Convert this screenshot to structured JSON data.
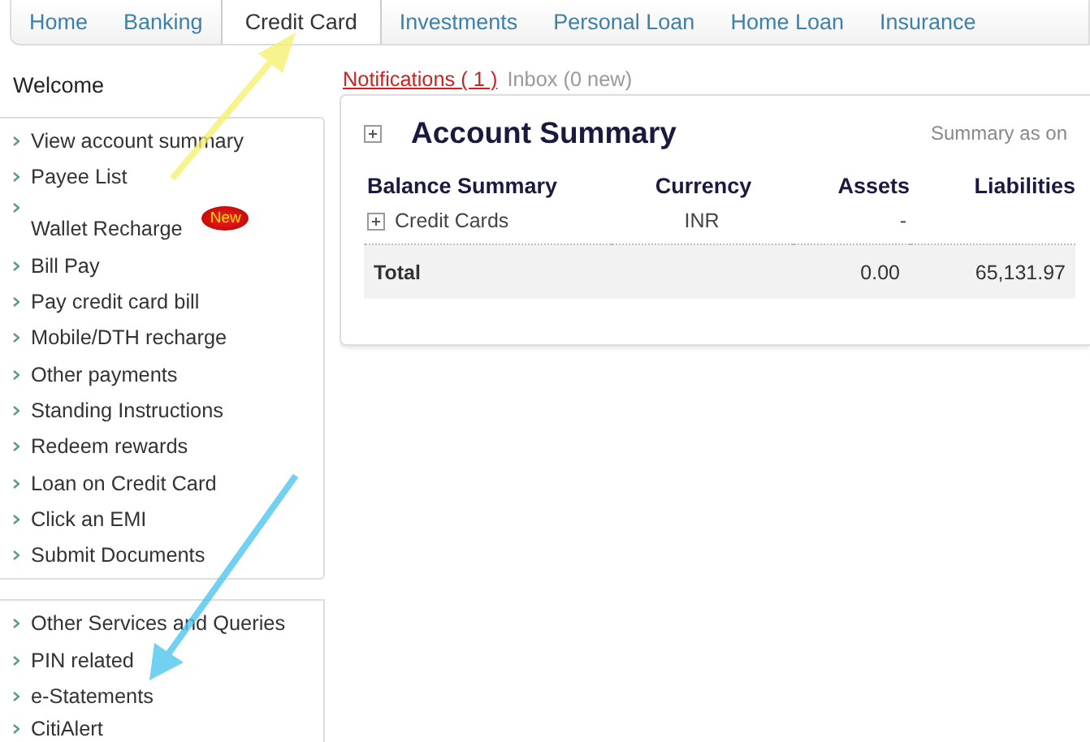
{
  "nav": {
    "tabs": [
      {
        "label": "Home",
        "selected": false
      },
      {
        "label": "Banking",
        "selected": false
      },
      {
        "label": "Credit Card",
        "selected": true
      },
      {
        "label": "Investments",
        "selected": false
      },
      {
        "label": "Personal Loan",
        "selected": false
      },
      {
        "label": "Home Loan",
        "selected": false
      },
      {
        "label": "Insurance",
        "selected": false
      }
    ]
  },
  "welcome": "Welcome",
  "sidebar": {
    "groups": [
      {
        "items": [
          {
            "label": "View account summary"
          },
          {
            "label": "Payee List"
          },
          {
            "label": "Wallet Recharge",
            "badge": "New"
          },
          {
            "label": "Bill Pay"
          },
          {
            "label": "Pay credit card bill"
          },
          {
            "label": "Mobile/DTH recharge"
          },
          {
            "label": "Other payments"
          },
          {
            "label": "Standing Instructions"
          },
          {
            "label": "Redeem rewards"
          },
          {
            "label": "Loan on Credit Card"
          },
          {
            "label": "Click an EMI"
          },
          {
            "label": "Submit Documents"
          }
        ]
      },
      {
        "items": [
          {
            "label": "Other Services and Queries"
          },
          {
            "label": "PIN related"
          },
          {
            "label": "e-Statements"
          },
          {
            "label": "CitiAlert"
          }
        ]
      }
    ]
  },
  "messages": {
    "notifications": "Notifications ( 1 )",
    "inbox": "Inbox (0 new)"
  },
  "summary": {
    "title": "Account Summary",
    "as_of": "Summary as on",
    "columns": [
      "Balance Summary",
      "Currency",
      "Assets",
      "Liabilities"
    ],
    "rows": [
      {
        "kind": "group",
        "cells": [
          "Credit Cards",
          "INR",
          "-",
          ""
        ]
      },
      {
        "kind": "total",
        "cells": [
          "Total",
          "",
          "0.00",
          "65,131.97"
        ]
      }
    ]
  }
}
